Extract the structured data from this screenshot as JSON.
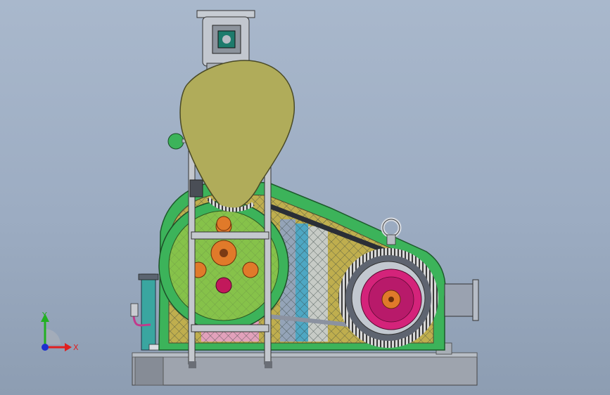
{
  "viewport": {
    "background_top": "#a9b8cc",
    "background_bottom": "#8d9db2"
  },
  "model": {
    "parts": [
      "base-frame",
      "hopper",
      "feeder-motor",
      "drive-housing",
      "large-pulley",
      "small-pulley",
      "v-belt",
      "motor",
      "outlet-duct",
      "lifting-eye",
      "support-legs",
      "oil-tank",
      "pressure-gauge"
    ],
    "colors": {
      "housing_green": "#3cb35a",
      "hopper_olive": "#b0ac5a",
      "mesh_olive": "#bfae4e",
      "pulley_green": "#86c24a",
      "hub_orange": "#e07a2a",
      "motor_magenta": "#d4237a",
      "steel_gray": "#9aa0a8",
      "teal_tank": "#3aa6a0"
    }
  },
  "triad": {
    "y_label": "Y",
    "x_label": "X",
    "y_color": "#22b022",
    "x_color": "#e02020",
    "z_color": "#1d2fd0"
  }
}
